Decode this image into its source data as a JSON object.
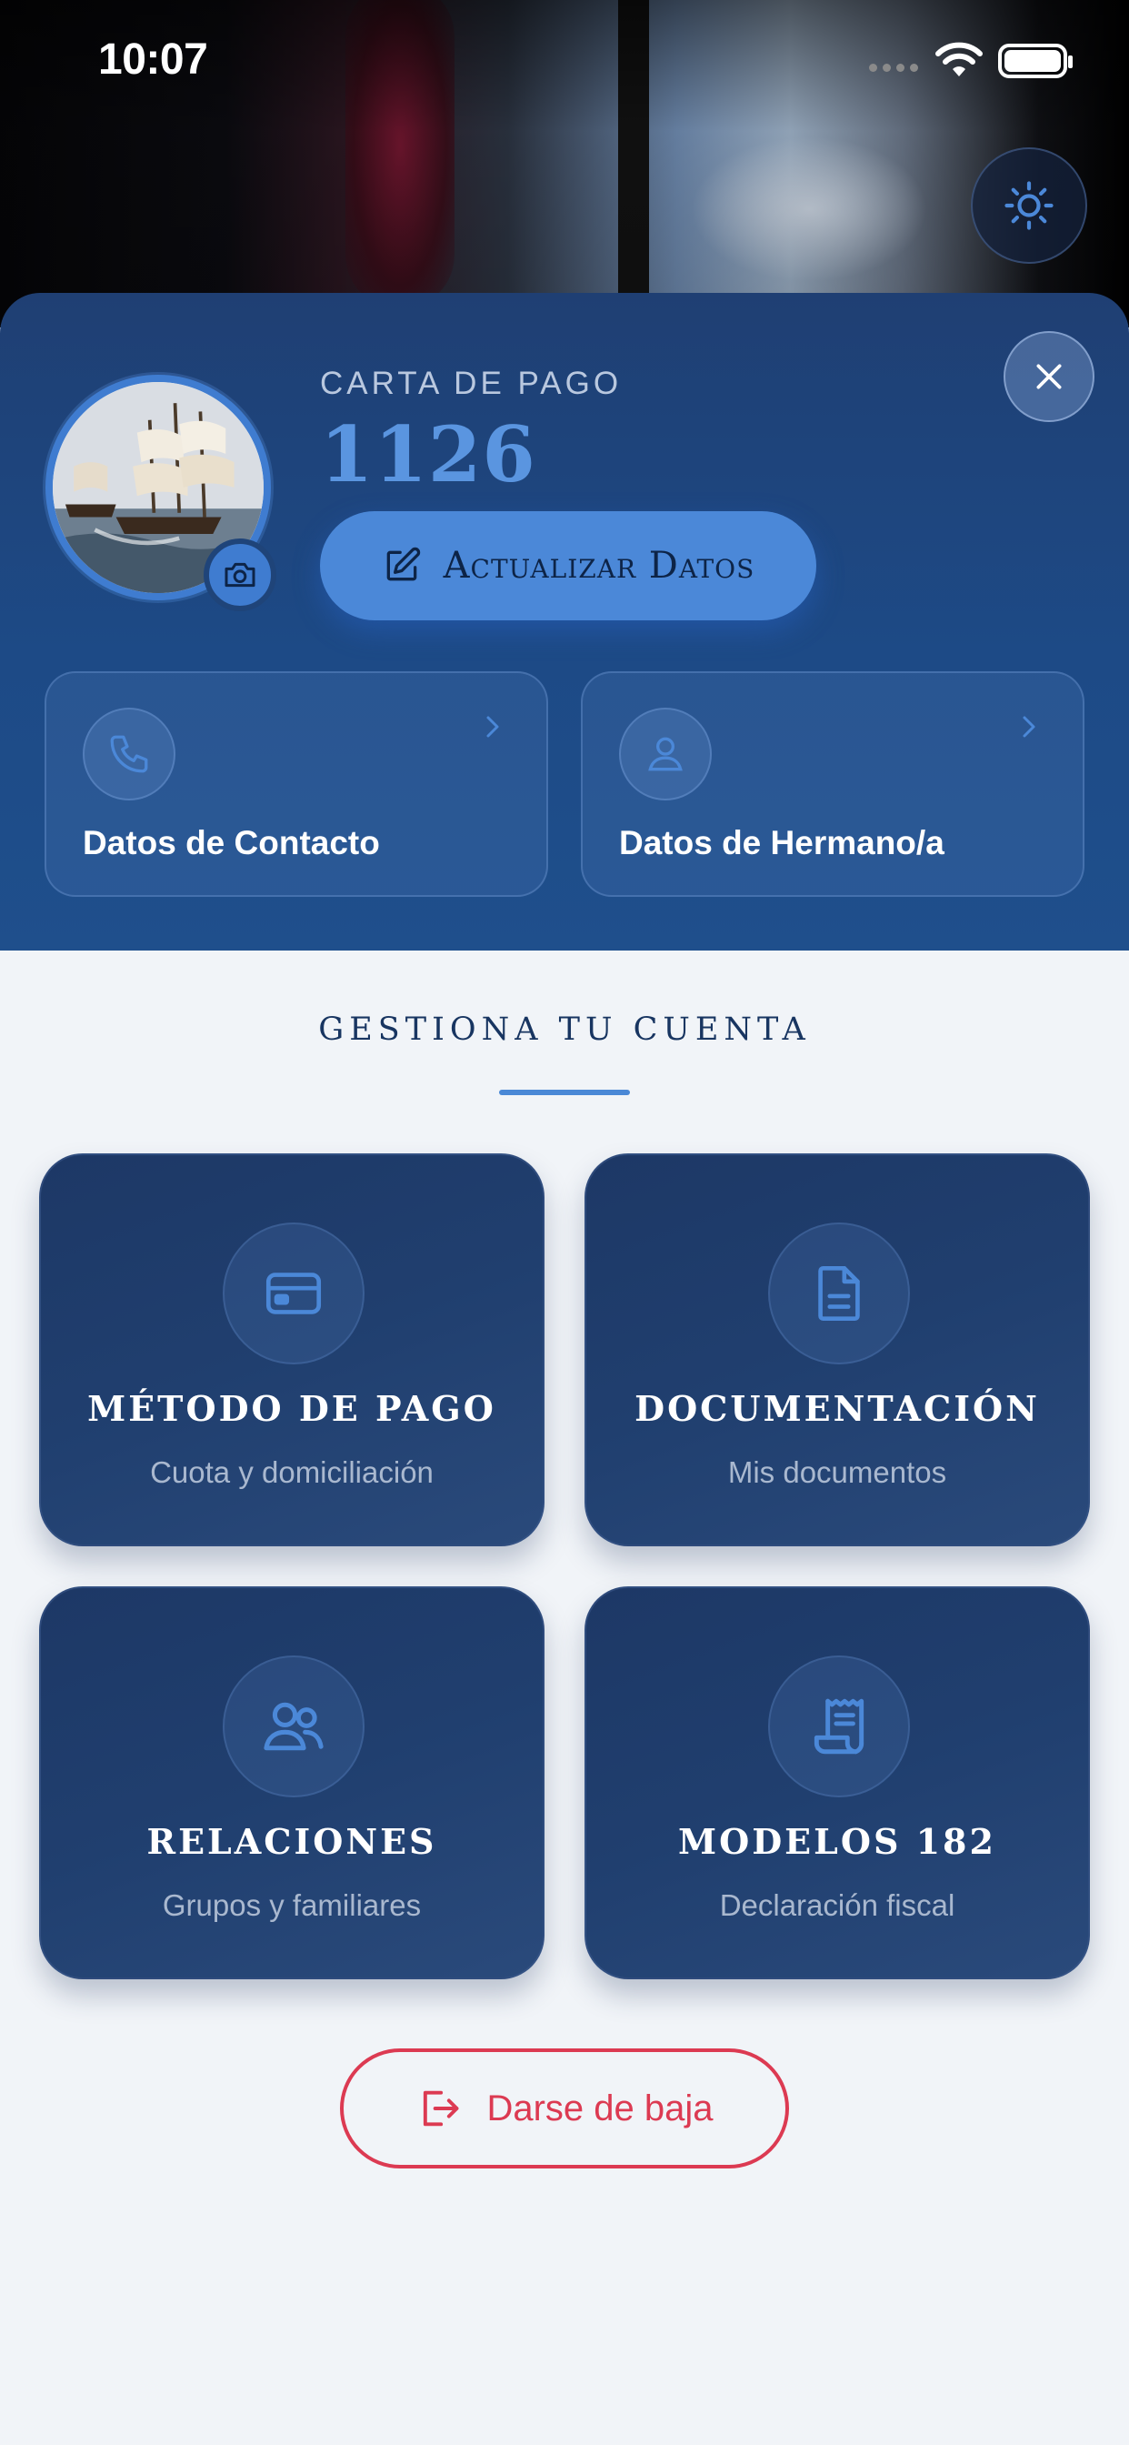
{
  "status_bar": {
    "time": "10:07"
  },
  "profile": {
    "card_label": "CARTA DE PAGO",
    "card_number": "1126",
    "update_button": "Actualizar Datos"
  },
  "info_cards": [
    {
      "title": "Datos de Contacto",
      "icon": "phone-icon"
    },
    {
      "title": "Datos de Hermano/a",
      "icon": "user-icon"
    }
  ],
  "section": {
    "title": "GESTIONA TU CUENTA"
  },
  "tiles": [
    {
      "title": "MÉTODO DE PAGO",
      "subtitle": "Cuota y domiciliación",
      "icon": "credit-card-icon"
    },
    {
      "title": "DOCUMENTACIÓN",
      "subtitle": "Mis documentos",
      "icon": "document-icon"
    },
    {
      "title": "RELACIONES",
      "subtitle": "Grupos y familiares",
      "icon": "users-icon"
    },
    {
      "title": "MODELOS 182",
      "subtitle": "Declaración fiscal",
      "icon": "receipt-scroll-icon"
    }
  ],
  "leave_button": "Darse de baja",
  "colors": {
    "accent": "#4b88d8",
    "danger": "#dc3a52",
    "panel": "#1f4479",
    "tile": "#203f6f"
  }
}
